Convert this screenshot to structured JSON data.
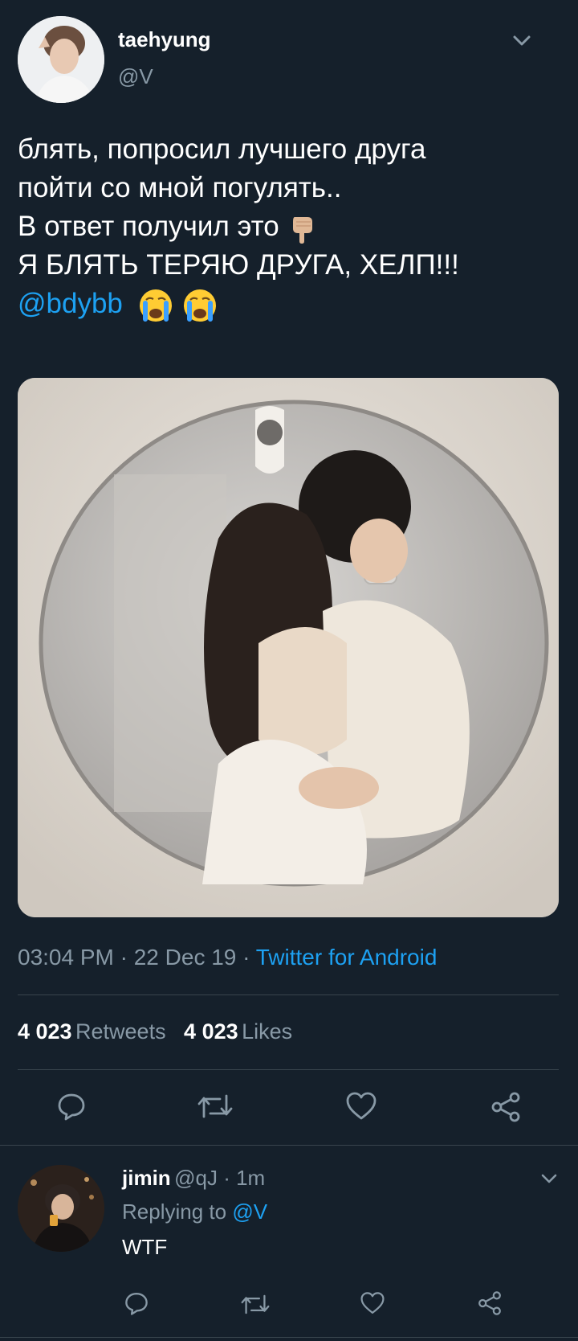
{
  "tweet": {
    "author_name": "taehyung",
    "author_handle": "@V",
    "text_line1": "блять, попросил лучшего друга",
    "text_line2": "пойти со мной погулять..",
    "text_line3": "В ответ получил это",
    "text_line4": "Я БЛЯТЬ ТЕРЯЮ ДРУГА, ХЕЛП!!!",
    "mention": "@bdybb",
    "timestamp": "03:04 PM · 22 Dec 19 · ",
    "source": "Twitter for Android",
    "retweets_count": "4 023",
    "retweets_label": "Retweets",
    "likes_count": "4 023",
    "likes_label": "Likes"
  },
  "reply": {
    "author_name": "jimin",
    "meta": "@qJ · 1m",
    "replying_prefix": "Replying to",
    "replying_to": "@V",
    "text": "WTF"
  },
  "colors": {
    "background": "#15202b",
    "accent": "#1da1f2",
    "muted": "#8899a6",
    "divider": "#38444d"
  },
  "icons": {
    "reply": "reply-icon",
    "retweet": "retweet-icon",
    "like": "heart-icon",
    "share": "share-icon",
    "menu": "chevron-down-icon"
  }
}
